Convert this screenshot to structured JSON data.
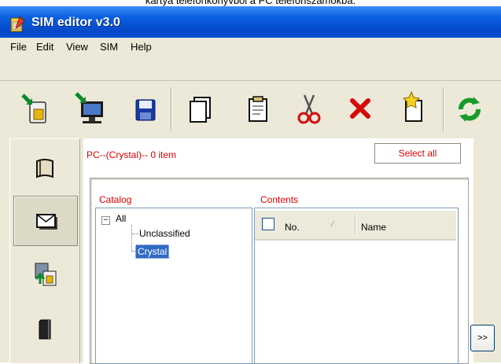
{
  "caption": "kártya telefonkönyvből a PC telefonszámokba.",
  "window": {
    "title": "SIM editor v3.0"
  },
  "menu": [
    {
      "label": "File"
    },
    {
      "label": "Edit"
    },
    {
      "label": "View"
    },
    {
      "label": "SIM"
    },
    {
      "label": "Help"
    }
  ],
  "toolbar": [
    {
      "icon": "sim-import-icon"
    },
    {
      "icon": "pc-export-icon"
    },
    {
      "icon": "save-icon"
    },
    {
      "icon": "copy-icon"
    },
    {
      "icon": "paste-icon"
    },
    {
      "icon": "cut-icon"
    },
    {
      "icon": "delete-icon"
    },
    {
      "icon": "new-icon"
    },
    {
      "icon": "refresh-icon"
    }
  ],
  "nav": [
    {
      "icon": "phonebook-icon"
    },
    {
      "icon": "message-icon",
      "selected": true
    },
    {
      "icon": "transfer-icon"
    },
    {
      "icon": "sim-card-icon"
    }
  ],
  "status": "PC--(Crystal)-- 0 item",
  "select_all": "Select all",
  "catalog": {
    "label": "Catalog",
    "toggle": "−",
    "root": "All",
    "children": [
      "Unclassified",
      "Crystal"
    ],
    "selected": "Crystal"
  },
  "contents": {
    "label": "Contents",
    "columns": [
      "No.",
      "Name"
    ],
    "sort_indicator": "⁄"
  },
  "more_button": ">>",
  "colors": {
    "accent_red": "#e00000",
    "title_blue": "#0548c8",
    "selection": "#316ac5"
  }
}
